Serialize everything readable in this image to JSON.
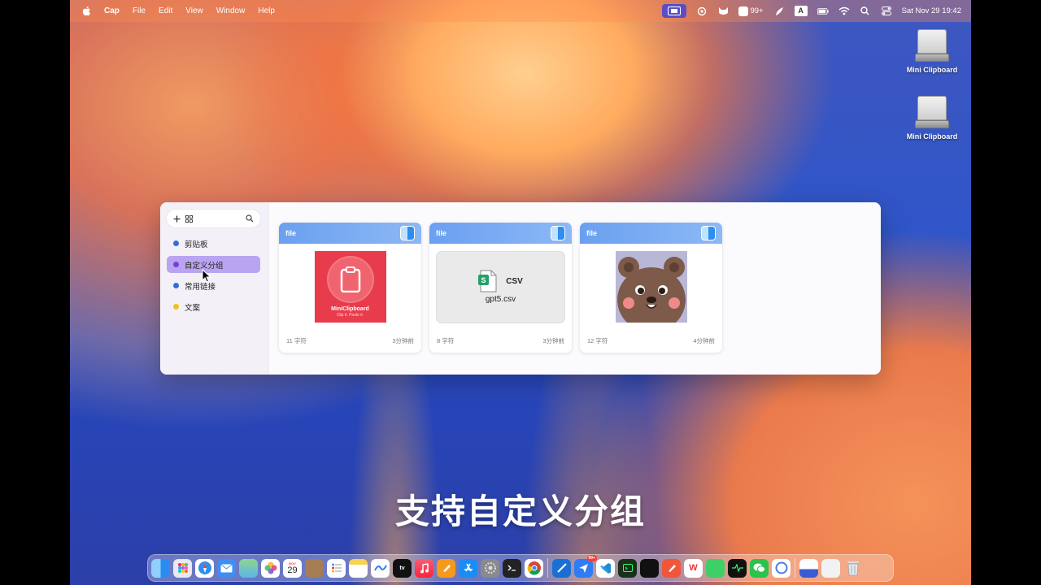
{
  "menubar": {
    "app_name": "Cap",
    "menus": [
      "File",
      "Edit",
      "View",
      "Window",
      "Help"
    ],
    "status_badge": "99+",
    "input_source": "A",
    "datetime": "Sat Nov 29  19:42"
  },
  "desktop": {
    "items": [
      {
        "label": "Mini Clipboard",
        "icon": "external-drive-icon"
      },
      {
        "label": "Mini Clipboard",
        "icon": "external-drive-icon"
      }
    ]
  },
  "clipboard_window": {
    "sidebar": {
      "groups": [
        {
          "label": "剪贴板",
          "color": "#2f6fd8"
        },
        {
          "label": "自定义分组",
          "color": "#7a3fd8"
        },
        {
          "label": "常用链接",
          "color": "#2f6fd8"
        },
        {
          "label": "文案",
          "color": "#f2c21a"
        }
      ],
      "active_group": "自定义分组"
    },
    "cards": [
      {
        "type_label": "file",
        "thumb_title": "MiniClipboard",
        "thumb_subtitle": "Clip it. Paste it.",
        "chars": "11 字符",
        "time": "3分钟前"
      },
      {
        "type_label": "file",
        "file_type": "CSV",
        "file_name": "gpt5.csv",
        "chars": "8 字符",
        "time": "3分钟前"
      },
      {
        "type_label": "file",
        "chars": "12 字符",
        "time": "4分钟前"
      }
    ]
  },
  "subtitle": "支持自定义分组",
  "dock": {
    "calendar_month": "NOV",
    "calendar_day": "29",
    "appletv_label": "tv",
    "notification_badge": "99+",
    "wps_label": "W"
  }
}
